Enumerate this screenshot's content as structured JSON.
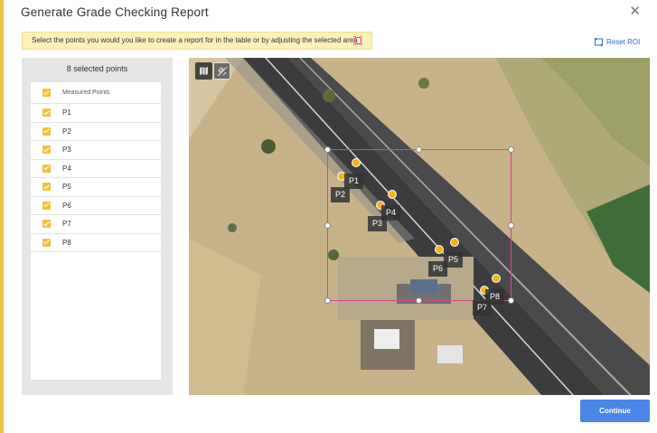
{
  "dialog": {
    "title": "Generate Grade Checking Report",
    "close_glyph": "✕",
    "instruction": "Select the points you would you like to create a report for in the table or by adjusting the selected area",
    "reset_roi_label": "Reset ROI",
    "continue_label": "Continue"
  },
  "points_panel": {
    "header": "8 selected points",
    "column_header": "Measured Points",
    "items": [
      {
        "label": "P1",
        "checked": true
      },
      {
        "label": "P2",
        "checked": true
      },
      {
        "label": "P3",
        "checked": true
      },
      {
        "label": "P4",
        "checked": true
      },
      {
        "label": "P5",
        "checked": true
      },
      {
        "label": "P6",
        "checked": true
      },
      {
        "label": "P7",
        "checked": true
      },
      {
        "label": "P8",
        "checked": true
      }
    ]
  },
  "map": {
    "toolbar": [
      {
        "name": "map-layer-icon"
      },
      {
        "name": "satellite-toggle-icon",
        "active": true
      }
    ],
    "point_labels": [
      "P1",
      "P2",
      "P3",
      "P4",
      "P5",
      "P6",
      "P7",
      "P8"
    ]
  },
  "colors": {
    "accent_yellow": "#eec33b",
    "roi_border": "#d6458d",
    "primary_button": "#4a86e8",
    "link_blue": "#2d6bd6",
    "banner_bg": "#fbf2b8"
  }
}
